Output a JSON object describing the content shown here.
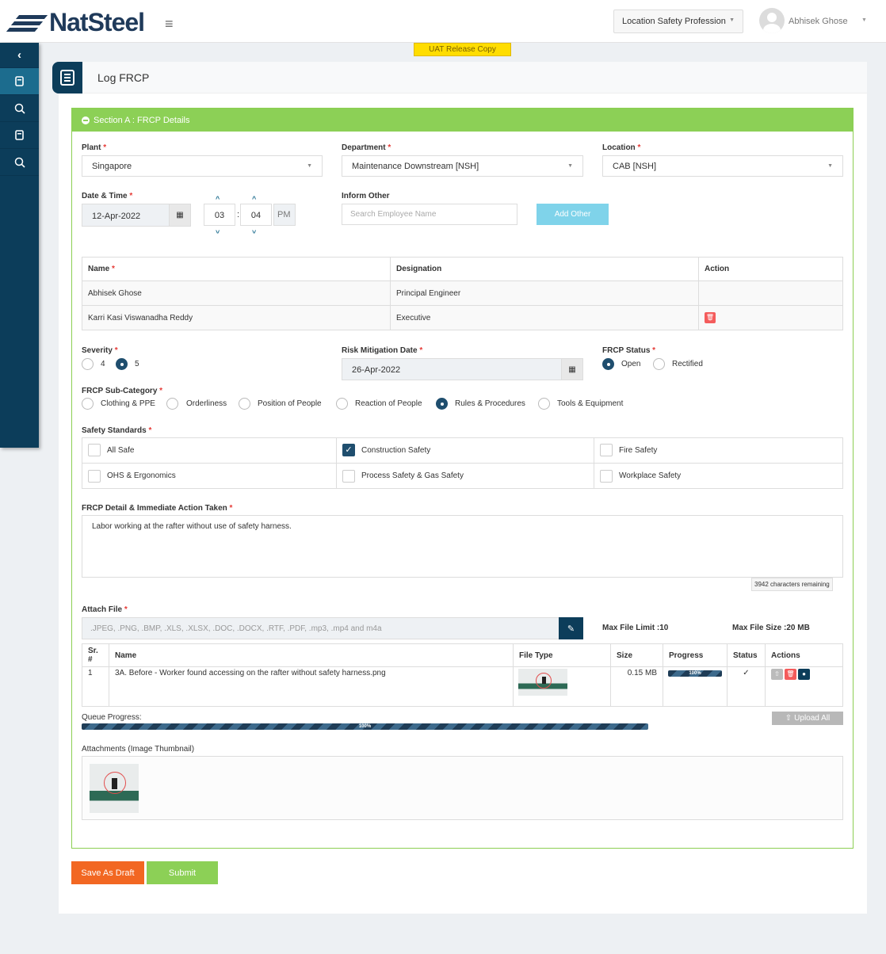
{
  "header": {
    "brand": "NatSteel",
    "role": "Location Safety Profession",
    "user": "Abhisek Ghose"
  },
  "banner": "UAT Release Copy",
  "page": {
    "title": "Log FRCP"
  },
  "section": {
    "title": "Section A : FRCP Details"
  },
  "fields": {
    "plant": {
      "label": "Plant",
      "value": "Singapore"
    },
    "department": {
      "label": "Department",
      "value": "Maintenance Downstream [NSH]"
    },
    "location": {
      "label": "Location",
      "value": "CAB [NSH]"
    },
    "datetime": {
      "label": "Date & Time",
      "date": "12-Apr-2022",
      "hour": "03",
      "colon": ":",
      "minute": "04",
      "ampm": "PM"
    },
    "inform_other": {
      "label": "Inform Other",
      "placeholder": "Search Employee Name",
      "button": "Add Other"
    }
  },
  "employees": {
    "headers": {
      "name": "Name",
      "designation": "Designation",
      "action": "Action"
    },
    "rows": [
      {
        "name": "Abhisek Ghose",
        "designation": "Principal Engineer"
      },
      {
        "name": "Karri Kasi Viswanadha Reddy",
        "designation": "Executive"
      }
    ]
  },
  "severity": {
    "label": "Severity",
    "options": [
      "4",
      "5"
    ],
    "selected": "5"
  },
  "risk_mitigation": {
    "label": "Risk Mitigation Date",
    "value": "26-Apr-2022"
  },
  "frcp_status": {
    "label": "FRCP Status",
    "options": [
      "Open",
      "Rectified"
    ],
    "selected": "Open"
  },
  "subcategory": {
    "label": "FRCP Sub-Category",
    "options": [
      "Clothing & PPE",
      "Orderliness",
      "Position of People",
      "Reaction of People",
      "Rules & Procedures",
      "Tools & Equipment"
    ],
    "selected": "Rules & Procedures"
  },
  "safety_standards": {
    "label": "Safety Standards",
    "items": [
      {
        "label": "All Safe",
        "checked": false
      },
      {
        "label": "Construction Safety",
        "checked": true
      },
      {
        "label": "Fire Safety",
        "checked": false
      },
      {
        "label": "OHS & Ergonomics",
        "checked": false
      },
      {
        "label": "Process Safety & Gas Safety",
        "checked": false
      },
      {
        "label": "Workplace Safety",
        "checked": false
      }
    ]
  },
  "detail": {
    "label": "FRCP Detail & Immediate Action Taken",
    "value": "Labor working at the rafter without use of safety harness.",
    "counter": "3942 characters remaining"
  },
  "attach": {
    "label": "Attach File",
    "placeholder": ".JPEG, .PNG, .BMP, .XLS, .XLSX, .DOC, .DOCX, .RTF, .PDF, .mp3, .mp4 and m4a",
    "max_limit": "Max File Limit :10",
    "max_size": "Max File Size :20 MB"
  },
  "files": {
    "headers": {
      "sr": "Sr. #",
      "name": "Name",
      "type": "File Type",
      "size": "Size",
      "progress": "Progress",
      "status": "Status",
      "actions": "Actions"
    },
    "rows": [
      {
        "sr": "1",
        "name": "3A. Before - Worker found accessing on the rafter without safety harness.png",
        "size": "0.15 MB",
        "progress": "100%",
        "progress_value": 1.0,
        "status": "✓"
      }
    ]
  },
  "queue": {
    "label": "Queue Progress:",
    "value": "100%",
    "progress_value": 1.0,
    "upload_all": "Upload All"
  },
  "attachments": {
    "label": "Attachments (Image Thumbnail)"
  },
  "actions": {
    "draft": "Save As Draft",
    "submit": "Submit"
  },
  "colors": {
    "accent": "#8cd056",
    "primary": "#0c3d5a",
    "danger": "#f45c5c",
    "draft": "#f26722"
  }
}
